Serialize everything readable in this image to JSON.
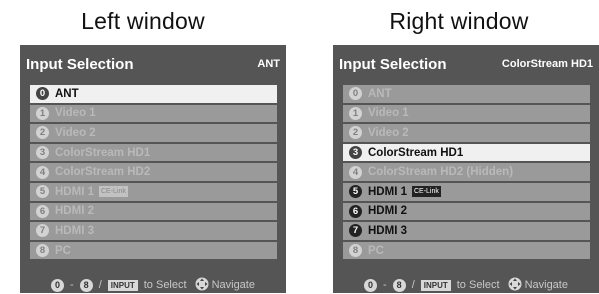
{
  "captions": {
    "left": "Left window",
    "right": "Right window"
  },
  "left": {
    "title": "Input Selection",
    "input": "ANT",
    "items": [
      {
        "num": "0",
        "label": "ANT",
        "badge": ""
      },
      {
        "num": "1",
        "label": "Video 1",
        "badge": ""
      },
      {
        "num": "2",
        "label": "Video 2",
        "badge": ""
      },
      {
        "num": "3",
        "label": "ColorStream HD1",
        "badge": ""
      },
      {
        "num": "4",
        "label": "ColorStream HD2",
        "badge": ""
      },
      {
        "num": "5",
        "label": "HDMI 1",
        "badge": "CE-Link"
      },
      {
        "num": "6",
        "label": "HDMI 2",
        "badge": ""
      },
      {
        "num": "7",
        "label": "HDMI 3",
        "badge": ""
      },
      {
        "num": "8",
        "label": "PC",
        "badge": ""
      }
    ],
    "footer": {
      "key_from": "0",
      "dash": "-",
      "key_to": "8",
      "slash": "/",
      "button": "INPUT",
      "select": "to Select",
      "navigate": "Navigate"
    }
  },
  "right": {
    "title": "Input Selection",
    "input": "ColorStream HD1",
    "items": [
      {
        "num": "0",
        "label": "ANT",
        "badge": ""
      },
      {
        "num": "1",
        "label": "Video 1",
        "badge": ""
      },
      {
        "num": "2",
        "label": "Video 2",
        "badge": ""
      },
      {
        "num": "3",
        "label": "ColorStream HD1",
        "badge": ""
      },
      {
        "num": "4",
        "label": "ColorStream HD2 (Hidden)",
        "badge": ""
      },
      {
        "num": "5",
        "label": "HDMI 1",
        "badge": "CE-Link"
      },
      {
        "num": "6",
        "label": "HDMI 2",
        "badge": ""
      },
      {
        "num": "7",
        "label": "HDMI 3",
        "badge": ""
      },
      {
        "num": "8",
        "label": "PC",
        "badge": ""
      }
    ],
    "footer": {
      "key_from": "0",
      "dash": "-",
      "key_to": "8",
      "slash": "/",
      "button": "INPUT",
      "select": "to Select",
      "navigate": "Navigate"
    }
  }
}
